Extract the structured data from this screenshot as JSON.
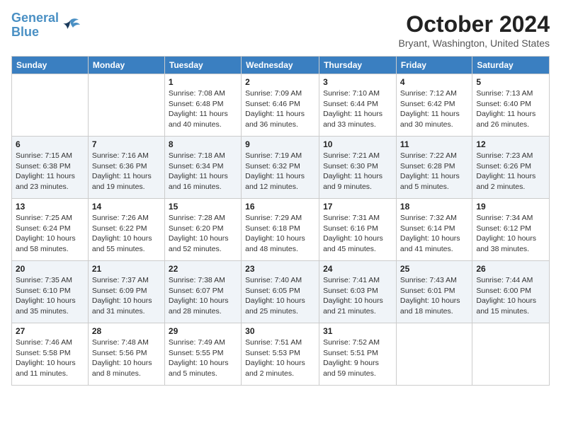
{
  "header": {
    "logo_line1": "General",
    "logo_line2": "Blue",
    "month": "October 2024",
    "location": "Bryant, Washington, United States"
  },
  "weekdays": [
    "Sunday",
    "Monday",
    "Tuesday",
    "Wednesday",
    "Thursday",
    "Friday",
    "Saturday"
  ],
  "weeks": [
    [
      {
        "day": "",
        "info": ""
      },
      {
        "day": "",
        "info": ""
      },
      {
        "day": "1",
        "info": "Sunrise: 7:08 AM\nSunset: 6:48 PM\nDaylight: 11 hours and 40 minutes."
      },
      {
        "day": "2",
        "info": "Sunrise: 7:09 AM\nSunset: 6:46 PM\nDaylight: 11 hours and 36 minutes."
      },
      {
        "day": "3",
        "info": "Sunrise: 7:10 AM\nSunset: 6:44 PM\nDaylight: 11 hours and 33 minutes."
      },
      {
        "day": "4",
        "info": "Sunrise: 7:12 AM\nSunset: 6:42 PM\nDaylight: 11 hours and 30 minutes."
      },
      {
        "day": "5",
        "info": "Sunrise: 7:13 AM\nSunset: 6:40 PM\nDaylight: 11 hours and 26 minutes."
      }
    ],
    [
      {
        "day": "6",
        "info": "Sunrise: 7:15 AM\nSunset: 6:38 PM\nDaylight: 11 hours and 23 minutes."
      },
      {
        "day": "7",
        "info": "Sunrise: 7:16 AM\nSunset: 6:36 PM\nDaylight: 11 hours and 19 minutes."
      },
      {
        "day": "8",
        "info": "Sunrise: 7:18 AM\nSunset: 6:34 PM\nDaylight: 11 hours and 16 minutes."
      },
      {
        "day": "9",
        "info": "Sunrise: 7:19 AM\nSunset: 6:32 PM\nDaylight: 11 hours and 12 minutes."
      },
      {
        "day": "10",
        "info": "Sunrise: 7:21 AM\nSunset: 6:30 PM\nDaylight: 11 hours and 9 minutes."
      },
      {
        "day": "11",
        "info": "Sunrise: 7:22 AM\nSunset: 6:28 PM\nDaylight: 11 hours and 5 minutes."
      },
      {
        "day": "12",
        "info": "Sunrise: 7:23 AM\nSunset: 6:26 PM\nDaylight: 11 hours and 2 minutes."
      }
    ],
    [
      {
        "day": "13",
        "info": "Sunrise: 7:25 AM\nSunset: 6:24 PM\nDaylight: 10 hours and 58 minutes."
      },
      {
        "day": "14",
        "info": "Sunrise: 7:26 AM\nSunset: 6:22 PM\nDaylight: 10 hours and 55 minutes."
      },
      {
        "day": "15",
        "info": "Sunrise: 7:28 AM\nSunset: 6:20 PM\nDaylight: 10 hours and 52 minutes."
      },
      {
        "day": "16",
        "info": "Sunrise: 7:29 AM\nSunset: 6:18 PM\nDaylight: 10 hours and 48 minutes."
      },
      {
        "day": "17",
        "info": "Sunrise: 7:31 AM\nSunset: 6:16 PM\nDaylight: 10 hours and 45 minutes."
      },
      {
        "day": "18",
        "info": "Sunrise: 7:32 AM\nSunset: 6:14 PM\nDaylight: 10 hours and 41 minutes."
      },
      {
        "day": "19",
        "info": "Sunrise: 7:34 AM\nSunset: 6:12 PM\nDaylight: 10 hours and 38 minutes."
      }
    ],
    [
      {
        "day": "20",
        "info": "Sunrise: 7:35 AM\nSunset: 6:10 PM\nDaylight: 10 hours and 35 minutes."
      },
      {
        "day": "21",
        "info": "Sunrise: 7:37 AM\nSunset: 6:09 PM\nDaylight: 10 hours and 31 minutes."
      },
      {
        "day": "22",
        "info": "Sunrise: 7:38 AM\nSunset: 6:07 PM\nDaylight: 10 hours and 28 minutes."
      },
      {
        "day": "23",
        "info": "Sunrise: 7:40 AM\nSunset: 6:05 PM\nDaylight: 10 hours and 25 minutes."
      },
      {
        "day": "24",
        "info": "Sunrise: 7:41 AM\nSunset: 6:03 PM\nDaylight: 10 hours and 21 minutes."
      },
      {
        "day": "25",
        "info": "Sunrise: 7:43 AM\nSunset: 6:01 PM\nDaylight: 10 hours and 18 minutes."
      },
      {
        "day": "26",
        "info": "Sunrise: 7:44 AM\nSunset: 6:00 PM\nDaylight: 10 hours and 15 minutes."
      }
    ],
    [
      {
        "day": "27",
        "info": "Sunrise: 7:46 AM\nSunset: 5:58 PM\nDaylight: 10 hours and 11 minutes."
      },
      {
        "day": "28",
        "info": "Sunrise: 7:48 AM\nSunset: 5:56 PM\nDaylight: 10 hours and 8 minutes."
      },
      {
        "day": "29",
        "info": "Sunrise: 7:49 AM\nSunset: 5:55 PM\nDaylight: 10 hours and 5 minutes."
      },
      {
        "day": "30",
        "info": "Sunrise: 7:51 AM\nSunset: 5:53 PM\nDaylight: 10 hours and 2 minutes."
      },
      {
        "day": "31",
        "info": "Sunrise: 7:52 AM\nSunset: 5:51 PM\nDaylight: 9 hours and 59 minutes."
      },
      {
        "day": "",
        "info": ""
      },
      {
        "day": "",
        "info": ""
      }
    ]
  ]
}
